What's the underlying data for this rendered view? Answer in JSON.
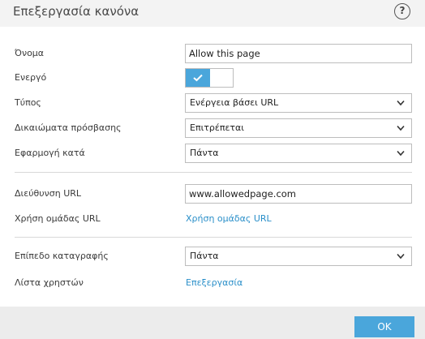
{
  "window": {
    "title": "Επεξεργασία κανόνα",
    "help_label": "?"
  },
  "form": {
    "name": {
      "label": "Όνομα",
      "value": "Allow this page"
    },
    "active": {
      "label": "Ενεργό",
      "enabled": true
    },
    "type": {
      "label": "Τύπος",
      "value": "Ενέργεια βάσει URL"
    },
    "access": {
      "label": "Δικαιώματα πρόσβασης",
      "value": "Επιτρέπεται"
    },
    "apply": {
      "label": "Εφαρμογή κατά",
      "value": "Πάντα"
    },
    "url": {
      "label": "Διεύθυνση URL",
      "value": "www.allowedpage.com"
    },
    "url_group": {
      "label": "Χρήση ομάδας URL",
      "link": "Χρήση ομάδας URL"
    },
    "log_level": {
      "label": "Επίπεδο καταγραφής",
      "value": "Πάντα"
    },
    "user_list": {
      "label": "Λίστα χρηστών",
      "link": "Επεξεργασία"
    }
  },
  "footer": {
    "ok_label": "OK"
  },
  "colors": {
    "accent": "#4aa6db",
    "link": "#2a8fc9"
  },
  "icons": {
    "help": "question-mark-icon",
    "check": "check-icon",
    "dropdown": "chevron-down-icon"
  }
}
